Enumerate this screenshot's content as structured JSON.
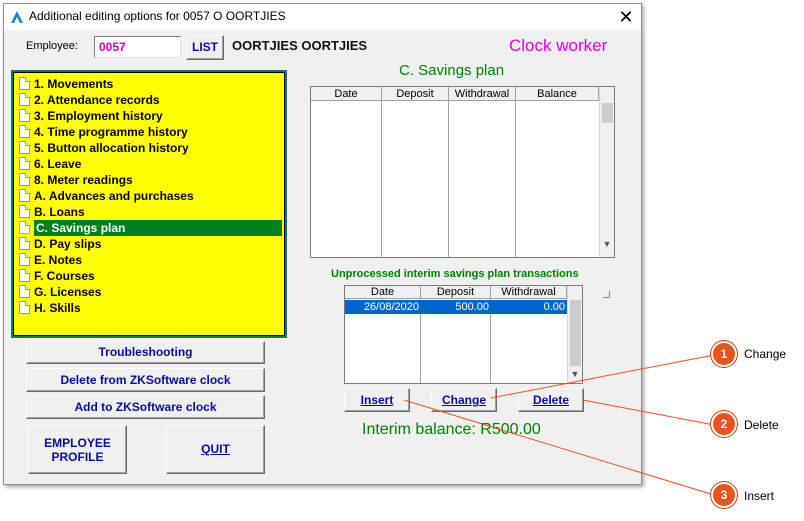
{
  "window": {
    "title": "Additional editing options for 0057 O OORTJIES",
    "close_glyph": "✕"
  },
  "employee": {
    "label": "Employee:",
    "number": "0057",
    "list_button": "LIST",
    "name": "OORTJIES OORTJIES",
    "type": "Clock worker"
  },
  "tree": {
    "items": [
      {
        "label": "1. Movements"
      },
      {
        "label": "2. Attendance records"
      },
      {
        "label": "3. Employment history"
      },
      {
        "label": "4. Time programme history"
      },
      {
        "label": "5. Button allocation history"
      },
      {
        "label": "6. Leave"
      },
      {
        "label": "8. Meter readings"
      },
      {
        "label": "A. Advances and purchases"
      },
      {
        "label": "B. Loans"
      },
      {
        "label": "C. Savings plan",
        "selected": true
      },
      {
        "label": "D. Pay slips"
      },
      {
        "label": "E. Notes"
      },
      {
        "label": "F. Courses"
      },
      {
        "label": "G. Licenses"
      },
      {
        "label": "H. Skills"
      }
    ]
  },
  "buttons": {
    "troubleshooting": "Troubleshooting",
    "delete_zk": "Delete from ZKSoftware clock",
    "add_zk": "Add to ZKSoftware clock",
    "employee_profile_line1": "EMPLOYEE",
    "employee_profile_line2": "PROFILE",
    "quit": "QUIT"
  },
  "savings": {
    "title": "C. Savings plan",
    "columns": [
      "Date",
      "Deposit",
      "Withdrawal",
      "Balance"
    ]
  },
  "interim": {
    "title": "Unprocessed interim savings plan transactions",
    "columns": [
      "Date",
      "Deposit",
      "Withdrawal"
    ],
    "rows": [
      {
        "date": "26/08/2020",
        "deposit": "500.00",
        "withdrawal": "0.00"
      }
    ],
    "insert": "Insert",
    "change": "Change",
    "delete": "Delete",
    "balance_text": "Interim balance: R500.00"
  },
  "callouts": [
    {
      "number": "1",
      "label": "Change"
    },
    {
      "number": "2",
      "label": "Delete"
    },
    {
      "number": "3",
      "label": "Insert"
    }
  ],
  "colors": {
    "tree_bg": "#ffff00",
    "selection": "#007f1f",
    "accent_green": "#008000",
    "magenta": "#e000e0",
    "callout": "#e8531f"
  }
}
